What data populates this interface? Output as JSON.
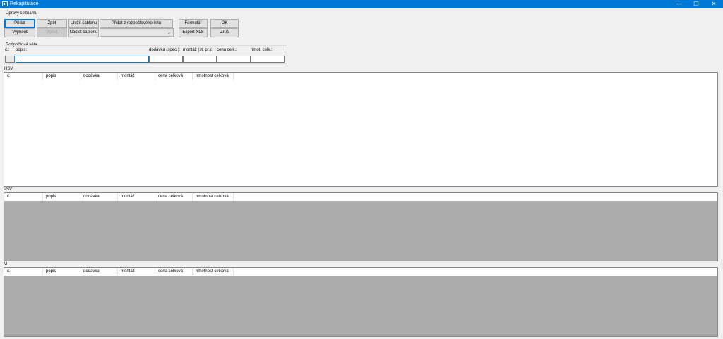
{
  "window": {
    "title": "Rekapitulace",
    "minimize_glyph": "—",
    "restore_glyph": "❐",
    "close_glyph": "✕"
  },
  "toolbar": {
    "group_title": "Úpravy seznamu",
    "add": "Přidat",
    "back": "Zpět",
    "save_template": "Uložit šablonu",
    "add_from_budget": "Přidat z rozpočtového listu",
    "form": "Formulář",
    "ok": "OK",
    "cut": "Vyjmout",
    "forward": "Vpřed",
    "load_template": "Načíst šablonu",
    "template_select_value": "",
    "export_xls": "Export XLS",
    "cancel": "Zruš"
  },
  "budget_line": {
    "group_title": "Rozpočtová věta",
    "labels": {
      "no": "č.:",
      "desc": "popis:",
      "supply": "dodávka (spec.):",
      "assembly": "montáž (st. pr.):",
      "total_price": "cena celk.:",
      "weight": "hmot. celk.:"
    }
  },
  "sections": [
    {
      "label": "HSV"
    },
    {
      "label": "PSV"
    },
    {
      "label": "M"
    }
  ],
  "columns": [
    "č.",
    "popis",
    "dodávka",
    "montáž",
    "cena celková",
    "hmotnost celková"
  ],
  "colors": {
    "titlebar": "#0078d7",
    "accent": "#0078d7",
    "grid_empty": "#ababab",
    "window_bg": "#f0f0f0"
  }
}
